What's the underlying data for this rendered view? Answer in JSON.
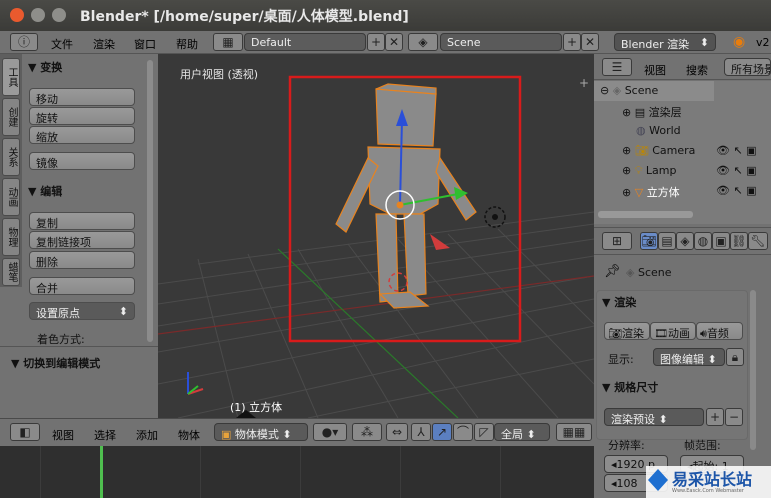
{
  "window": {
    "title": "Blender* [/home/super/桌面/人体模型.blend]"
  },
  "menubar": {
    "items": [
      "文件",
      "渲染",
      "窗口",
      "帮助"
    ],
    "layout": "Default",
    "scene": "Scene",
    "engine": "Blender 渲染",
    "version": "v2"
  },
  "toolshelf": {
    "tabs": [
      "工具",
      "创建",
      "关系",
      "动画",
      "物理",
      "蜡笔"
    ],
    "transform": {
      "header": "变换",
      "buttons": [
        "移动",
        "旋转",
        "缩放",
        "镜像"
      ]
    },
    "edit": {
      "header": "编辑",
      "buttons": [
        "复制",
        "复制链接项",
        "删除",
        "合并",
        "设置原点"
      ],
      "shading_label": "着色方式:"
    },
    "toggle_edit": "切换到编辑模式"
  },
  "viewport": {
    "label": "用户视图 (透视)",
    "object_label": "(1) 立方体",
    "plus": "+"
  },
  "bottombar": {
    "items": [
      "视图",
      "选择",
      "添加",
      "物体"
    ],
    "mode": "物体模式",
    "global": "全局"
  },
  "outliner": {
    "menu": [
      "视图",
      "搜索"
    ],
    "filter": "所有场景",
    "rows": [
      {
        "label": "Scene"
      },
      {
        "label": "渲染层"
      },
      {
        "label": "World"
      },
      {
        "label": "Camera"
      },
      {
        "label": "Lamp"
      },
      {
        "label": "立方体"
      }
    ]
  },
  "properties": {
    "scene_path": "Scene",
    "render_header": "渲染",
    "render_buttons": [
      "渲染",
      "动画",
      "音频"
    ],
    "display_label": "显示:",
    "display_value": "图像编辑",
    "dimensions_header": "规格尺寸",
    "preset": "渲染预设",
    "resolution_label": "分辨率:",
    "frame_range_label": "帧范围:",
    "res_x": "1920 p",
    "res_y": "108",
    "frame_start": "起始: 1"
  },
  "watermark": {
    "text": "易采站长站",
    "sub": "Www.Easck.Com Webmaster"
  },
  "colors": {
    "selection": "#e8831f",
    "highlight_box": "#e01a1a",
    "x_axis": "#d23c3c",
    "y_axis": "#2fbf2f",
    "z_axis": "#2a4fd8"
  }
}
